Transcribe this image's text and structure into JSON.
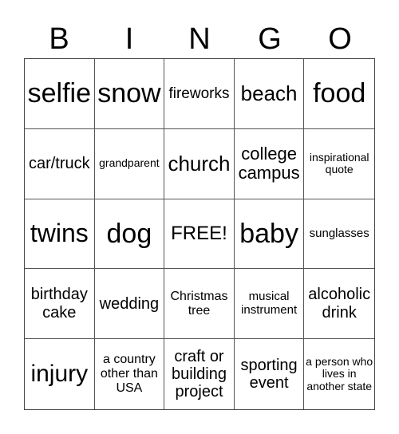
{
  "header": {
    "letters": [
      "B",
      "I",
      "N",
      "G",
      "O"
    ]
  },
  "cells": [
    [
      "selfie",
      "snow",
      "fireworks",
      "beach",
      "food"
    ],
    [
      "car/truck",
      "grandparent",
      "church",
      "college campus",
      "inspirational quote"
    ],
    [
      "twins",
      "dog",
      "FREE!",
      "baby",
      "sunglasses"
    ],
    [
      "birthday cake",
      "wedding",
      "Christmas tree",
      "musical instrument",
      "alcoholic drink"
    ],
    [
      "injury",
      "a country other than USA",
      "craft or building project",
      "sporting event",
      "a person who lives in another state"
    ]
  ]
}
